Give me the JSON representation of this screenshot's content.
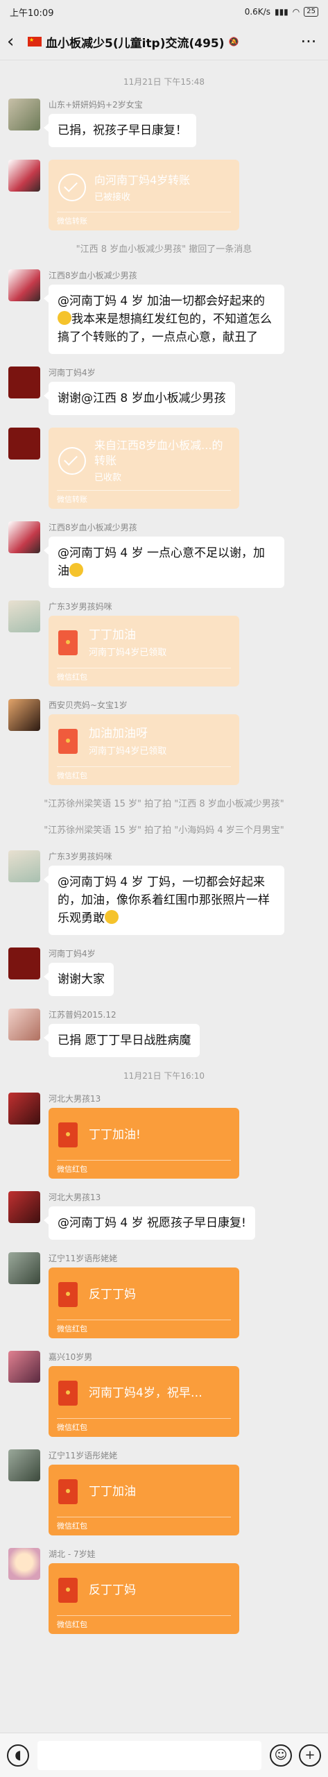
{
  "status_bar": {
    "time": "上午10:09",
    "speed": "0.6K/s",
    "battery": "25"
  },
  "nav": {
    "title": "血小板减少5(儿童itp)交流(495)"
  },
  "timestamps": [
    "11月21日 下午15:48",
    "11月21日 下午16:10"
  ],
  "messages": [
    {
      "sender": "山东+妍妍妈妈+2岁女宝",
      "text": "已捐，祝孩子早日康复！"
    },
    {
      "transfer_title": "向河南丁妈4岁转账",
      "transfer_status": "已被接收",
      "footer": "微信转账"
    },
    {
      "system": "\"江西 8 岁血小板减少男孩\" 撤回了一条消息"
    },
    {
      "sender": "江西8岁血小板减少男孩",
      "text": "@河南丁妈 4 岁  加油一切都会好起来的",
      "text2": "我本来是想搞红发红包的，不知道怎么搞了个转账的了，一点点心意，献丑了"
    },
    {
      "sender": "河南丁妈4岁",
      "text": "谢谢@江西 8 岁血小板减少男孩"
    },
    {
      "transfer_title": "来自江西8岁血小板减...的转账",
      "transfer_status": "已收款",
      "footer": "微信转账"
    },
    {
      "sender": "江西8岁血小板减少男孩",
      "text": "@河南丁妈 4 岁  一点心意不足以谢，加油"
    },
    {
      "sender": "广东3岁男孩妈咪",
      "hb_title": "丁丁加油",
      "hb_status": "河南丁妈4岁已领取",
      "footer": "微信红包"
    },
    {
      "sender": "西安贝壳妈~女宝1岁",
      "hb_title": "加油加油呀",
      "hb_status": "河南丁妈4岁已领取",
      "footer": "微信红包"
    },
    {
      "system": "\"江苏徐州梁笑语 15 岁\" 拍了拍 \"江西 8 岁血小板减少男孩\""
    },
    {
      "system": "\"江苏徐州梁笑语 15 岁\" 拍了拍 \"小海妈妈 4 岁三个月男宝\""
    },
    {
      "sender": "广东3岁男孩妈咪",
      "text": "@河南丁妈 4 岁  丁妈，一切都会好起来的，加油，像你系着红围巾那张照片一样乐观勇敢"
    },
    {
      "sender": "河南丁妈4岁",
      "text": "谢谢大家"
    },
    {
      "sender": "江苏普妈2015.12",
      "text": "已捐 愿丁丁早日战胜病魔"
    },
    {
      "sender": "河北大男孩13",
      "hb_title": "丁丁加油!",
      "footer": "微信红包"
    },
    {
      "sender": "河北大男孩13",
      "text": "@河南丁妈 4 岁  祝愿孩子早日康复!"
    },
    {
      "sender": "辽宁11岁语彤姥姥",
      "hb_title": "反丁丁妈",
      "footer": "微信红包"
    },
    {
      "sender": "嘉兴10岁男",
      "hb_title": "河南丁妈4岁，祝早…",
      "footer": "微信红包"
    },
    {
      "sender": "辽宁11岁语彤姥姥",
      "hb_title": "丁丁加油",
      "footer": "微信红包"
    },
    {
      "sender": "湖北 - 7岁娃",
      "hb_title": "反丁丁妈",
      "footer": "微信红包"
    }
  ],
  "colors": {
    "bg": "#ededed",
    "transfer_done": "#fbe2c4",
    "hongbao_new": "#fa9d3b",
    "hongbao_icon": "#e0411e"
  }
}
